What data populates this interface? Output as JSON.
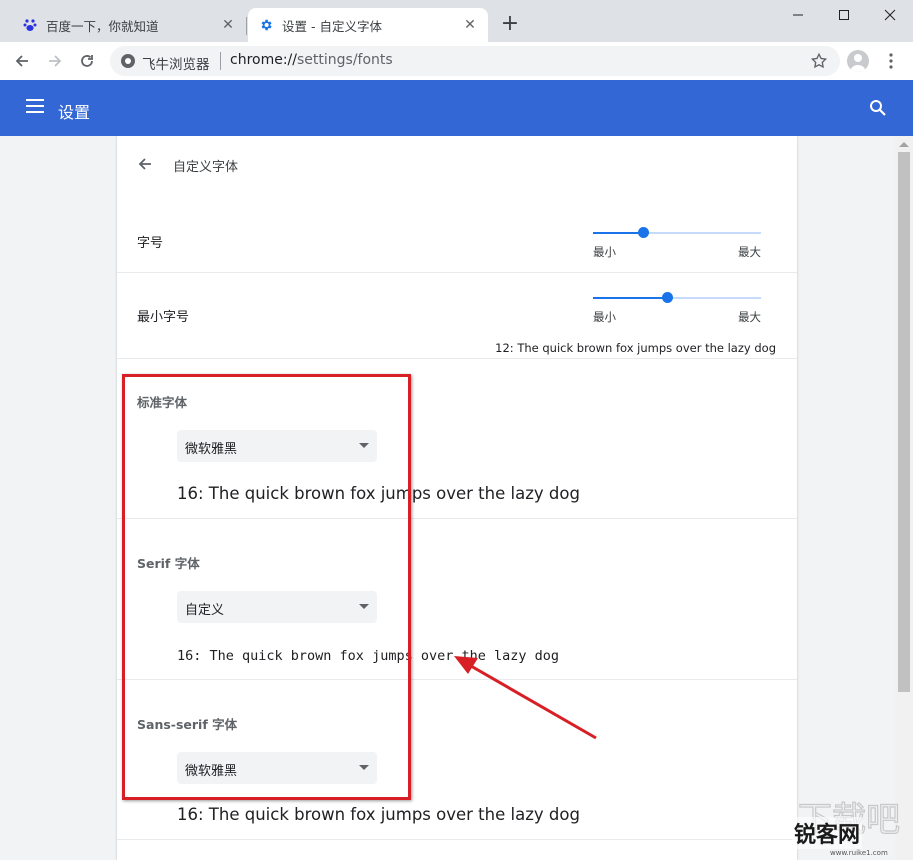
{
  "tabs": [
    {
      "title": "百度一下，你就知道",
      "icon": "baidu-paw-icon"
    },
    {
      "title": "设置 - 自定义字体",
      "icon": "settings-gear-icon"
    }
  ],
  "toolbar": {
    "site_name": "飞牛浏览器",
    "url_host": "chrome://",
    "url_path": "settings/fonts"
  },
  "header": {
    "title": "设置"
  },
  "subpage": {
    "title": "自定义字体"
  },
  "font_size": {
    "label": "字号",
    "min_label": "最小",
    "max_label": "最大",
    "level": 0.3
  },
  "min_font_size": {
    "label": "最小字号",
    "min_label": "最小",
    "max_label": "最大",
    "level": 0.44,
    "sample": "12: The quick brown fox jumps over the lazy dog"
  },
  "standard_font": {
    "label": "标准字体",
    "value": "微软雅黑",
    "sample": "16: The quick brown fox jumps over the lazy dog"
  },
  "serif_font": {
    "label": "Serif 字体",
    "value": "自定义",
    "sample": "16: The quick brown fox jumps over the lazy dog"
  },
  "sans_serif_font": {
    "label": "Sans-serif 字体",
    "value": "微软雅黑",
    "sample": "16: The quick brown fox jumps over the lazy dog"
  },
  "watermark": {
    "text": "锐客网",
    "url": "www.ruike1.com"
  },
  "colors": {
    "header": "#3367d6",
    "accent": "#1a73e8",
    "annotation": "#d81f26"
  }
}
